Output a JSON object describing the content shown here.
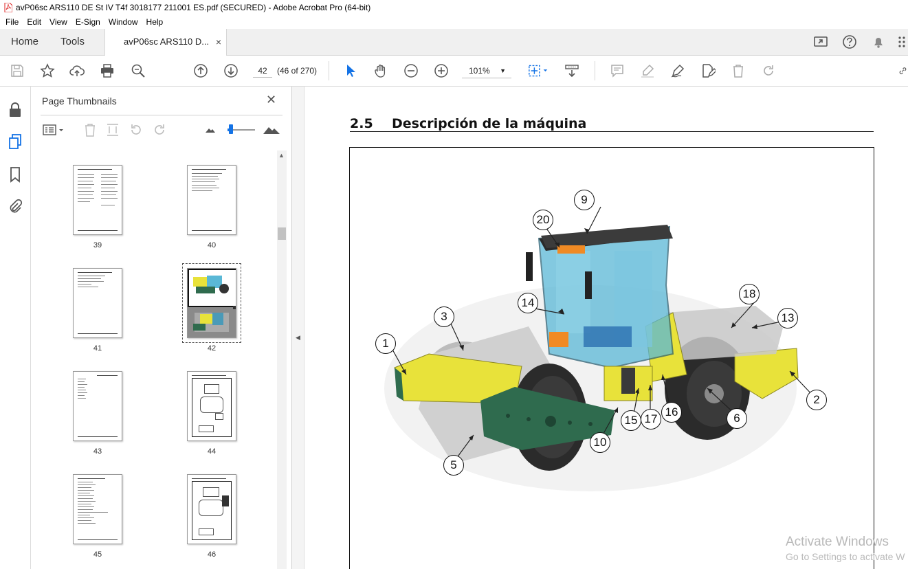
{
  "window": {
    "title": "avP06sc ARS110 DE St IV T4f 3018177 211001 ES.pdf (SECURED) - Adobe Acrobat Pro (64-bit)"
  },
  "menu": [
    "File",
    "Edit",
    "View",
    "E-Sign",
    "Window",
    "Help"
  ],
  "tabs": {
    "home": "Home",
    "tools": "Tools",
    "document": "avP06sc ARS110 D...",
    "close": "×"
  },
  "toolbar": {
    "page_value": "42",
    "page_count": "(46 of 270)",
    "zoom": "101%"
  },
  "thumbnails_panel": {
    "title": "Page Thumbnails",
    "close": "✕",
    "pages": [
      "39",
      "40",
      "41",
      "42",
      "43",
      "44",
      "45",
      "46"
    ],
    "selected_page": "42"
  },
  "document": {
    "section_number": "2.5",
    "section_title": "Descripción de la máquina",
    "callouts": [
      "1",
      "2",
      "3",
      "5",
      "6",
      "9",
      "10",
      "13",
      "14",
      "15",
      "16",
      "17",
      "18",
      "20"
    ]
  },
  "watermark": {
    "line1": "Activate Windows",
    "line2": "Go to Settings to activate W"
  },
  "colors": {
    "machine_yellow": "#e8e23a",
    "frame_green": "#2f6b4e",
    "drum_gray": "#c9c9c9",
    "cabin_blue": "#5ab8d6",
    "accent_blue": "#1473e6"
  }
}
